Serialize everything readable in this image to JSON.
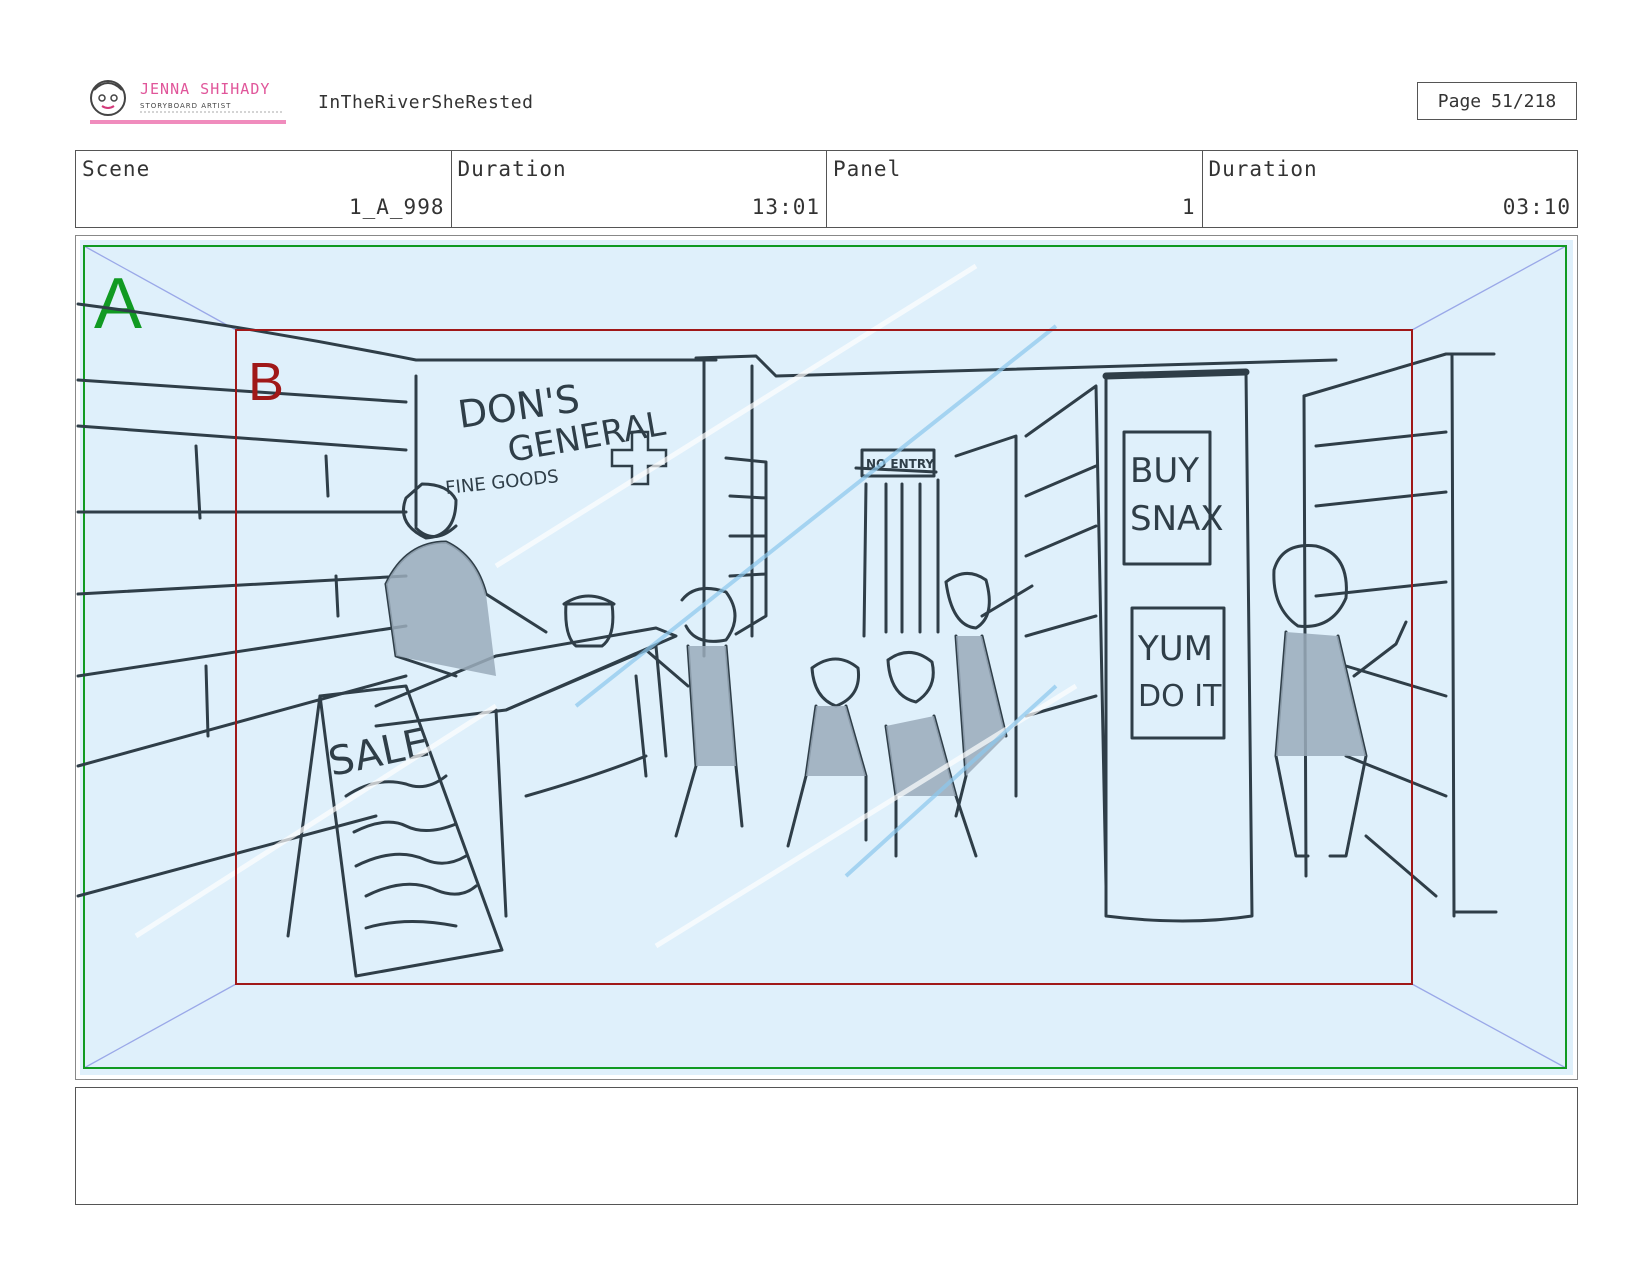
{
  "header": {
    "logo": {
      "name": "JENNA SHIHADY",
      "tagline": "STORYBOARD ARTIST"
    },
    "project_title": "InTheRiverSheRested",
    "page_label": "Page",
    "page_number": "51/218"
  },
  "info": {
    "scene_label": "Scene",
    "scene_value": "1_A_998",
    "duration_label": "Duration",
    "duration_value": "13:01",
    "panel_label": "Panel",
    "panel_value": "1",
    "panel_duration_label": "Duration",
    "panel_duration_value": "03:10"
  },
  "frame": {
    "outer_label": "A",
    "inner_label": "B",
    "outer_color": "#119a22",
    "inner_color": "#a01818",
    "background_color": "#dff0fb"
  },
  "sketch": {
    "store_sign": [
      "DON'S",
      "GENERAL",
      "FINE GOODS"
    ],
    "door_sign": "NO ENTRY",
    "sale_sign": "SALE",
    "poster_top": [
      "BUY",
      "SNAX"
    ],
    "poster_bottom": [
      "YUM",
      "DO IT"
    ]
  },
  "notes": ""
}
